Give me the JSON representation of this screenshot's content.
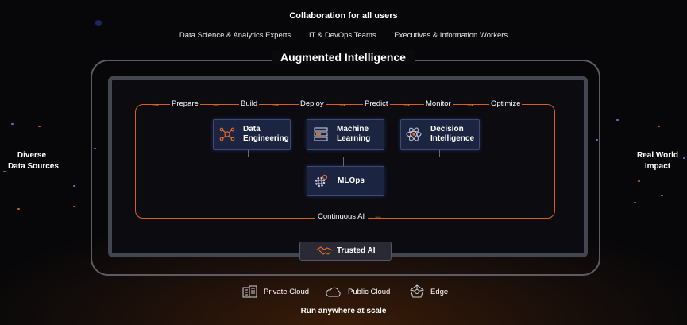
{
  "header": {
    "title": "Collaboration for all users",
    "user_groups": [
      "Data Science & Analytics Experts",
      "IT & DevOps Teams",
      "Executives & Information Workers"
    ]
  },
  "platform": {
    "title": "Augmented Intelligence",
    "steps": [
      "Prepare",
      "Build",
      "Deploy",
      "Predict",
      "Monitor",
      "Optimize"
    ],
    "boxes": {
      "data_engineering": "Data\nEngineering",
      "machine_learning": "Machine\nLearning",
      "decision_intelligence": "Decision\nIntelligence",
      "mlops": "MLOps"
    },
    "loop_label": "Continuous AI",
    "trusted": "Trusted AI"
  },
  "sides": {
    "left": "Diverse\nData Sources",
    "right": "Real World\nImpact"
  },
  "deployment": {
    "options": [
      "Private Cloud",
      "Public Cloud",
      "Edge"
    ],
    "tagline": "Run anywhere at scale"
  },
  "colors": {
    "accent": "#d9601a",
    "box_bg": "#1b2440",
    "frame": "#44464f"
  },
  "icons": {
    "data_engineering": "network-icon",
    "machine_learning": "server-stack-icon",
    "decision_intelligence": "atom-icon",
    "mlops": "gear-icon",
    "trusted": "handshake-icon",
    "private_cloud": "building-icon",
    "public_cloud": "cloud-icon",
    "edge": "edge-network-icon"
  }
}
